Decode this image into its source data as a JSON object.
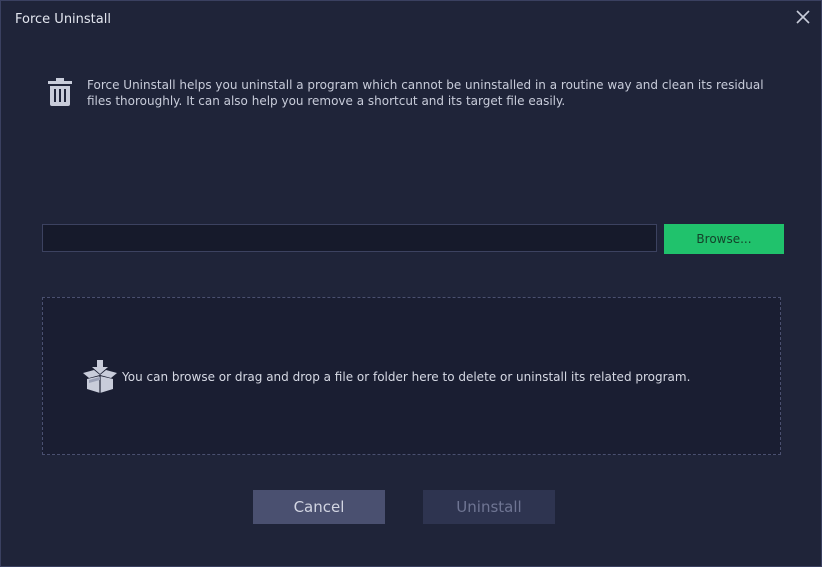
{
  "window": {
    "title": "Force Uninstall",
    "close_icon": "close-icon"
  },
  "info": {
    "icon": "trash-icon",
    "text": "Force Uninstall helps you uninstall a program which cannot be uninstalled in a routine way and clean its residual files thoroughly. It can also help you remove a shortcut and its target file easily."
  },
  "path_input": {
    "value": "",
    "placeholder": ""
  },
  "browse_button": {
    "label": "Browse..."
  },
  "drop_zone": {
    "icon": "box-drop-icon",
    "text": "You can browse or drag and drop a file or folder here to delete or uninstall its related program."
  },
  "footer": {
    "cancel_label": "Cancel",
    "uninstall_label": "Uninstall",
    "uninstall_enabled": false
  },
  "colors": {
    "background": "#1f2439",
    "accent_green": "#20c26c",
    "cancel_bg": "#4a5070",
    "disabled_bg": "#2e3450"
  }
}
